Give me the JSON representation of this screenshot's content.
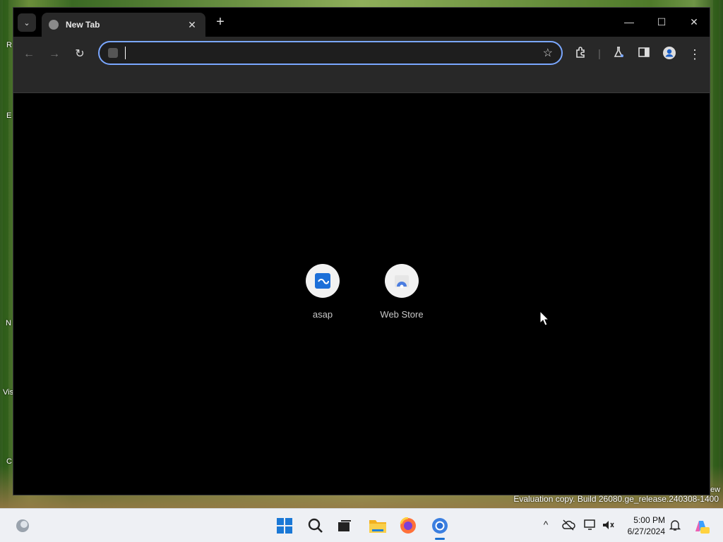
{
  "desktop": {
    "left_labels": [
      "R",
      "E",
      "N",
      "Vis",
      "C"
    ],
    "right_label": "ew",
    "watermark": "Evaluation copy. Build 26080.ge_release.240308-1400"
  },
  "browser": {
    "tab": {
      "title": "New Tab",
      "close_glyph": "✕"
    },
    "new_tab_glyph": "+",
    "tab_search_glyph": "⌄",
    "window_controls": {
      "minimize": "—",
      "maximize": "☐",
      "close": "✕"
    },
    "nav": {
      "back": "←",
      "forward": "→",
      "reload": "↻"
    },
    "omnibox": {
      "value": "",
      "placeholder": "",
      "star_glyph": "☆"
    },
    "toolbar_icons": [
      "extensions-icon",
      "labs-icon",
      "side-panel-icon",
      "profile-icon",
      "menu-icon"
    ],
    "shortcuts": [
      {
        "label": "asap",
        "icon": "asap-icon"
      },
      {
        "label": "Web Store",
        "icon": "web-store-icon"
      }
    ]
  },
  "taskbar": {
    "items": [
      "start-icon",
      "search-icon",
      "task-view-icon",
      "file-explorer-icon",
      "firefox-icon",
      "chrome-icon"
    ],
    "tray": {
      "chevron": "^"
    },
    "clock": {
      "time": "5:00 PM",
      "date": "6/27/2024"
    }
  },
  "colors": {
    "accent": "#7aa7ff",
    "window_bg": "#000000",
    "toolbar_bg": "#282828",
    "taskbar_bg": "#eef0f4"
  }
}
